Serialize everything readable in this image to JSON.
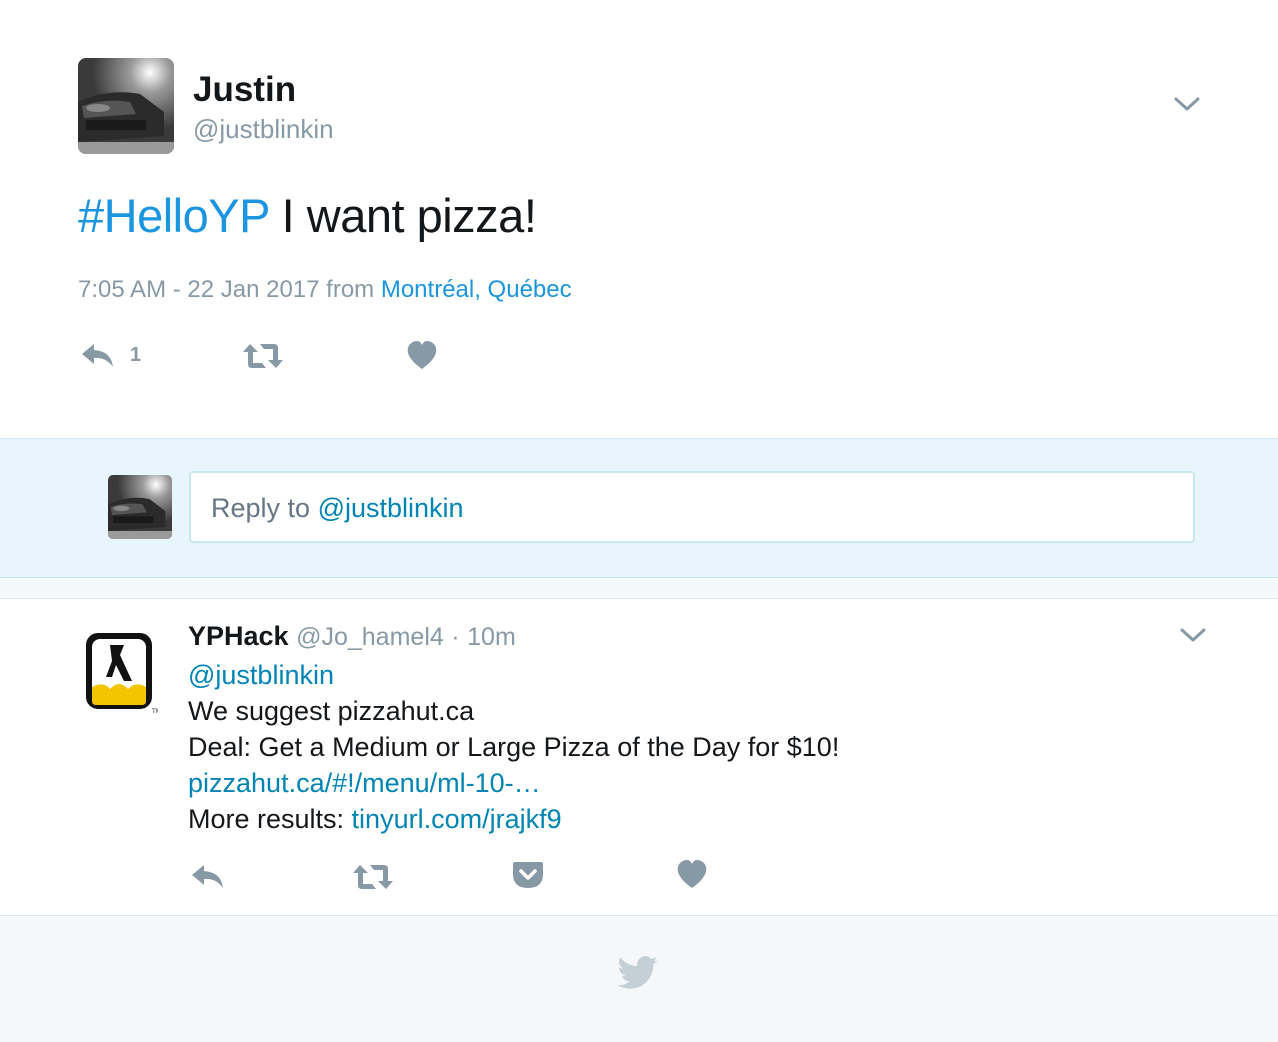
{
  "main_tweet": {
    "author_name": "Justin",
    "author_handle": "@justblinkin",
    "hashtag": "#HelloYP",
    "text": " I want pizza!",
    "timestamp": "7:05 AM - 22 Jan 2017 from ",
    "location": "Montréal, Québec",
    "reply_count": "1",
    "icons": [
      "reply-icon",
      "retweet-icon",
      "like-icon",
      "chevron-down-icon"
    ]
  },
  "reply_composer": {
    "placeholder_prefix": "Reply to ",
    "placeholder_mention": "@justblinkin"
  },
  "reply_tweet": {
    "author_name": "YPHack",
    "author_handle": "@Jo_hamel4",
    "separator": "·",
    "time": "10m",
    "lines": {
      "mention": "@justblinkin",
      "line1": "We suggest pizzahut.ca",
      "line2": "Deal: Get a Medium or Large Pizza of the Day for $10!",
      "link1": "pizzahut.ca/#!/menu/ml-10-…",
      "more_label": "More results: ",
      "link2": "tinyurl.com/jrajkf9"
    },
    "icons": [
      "reply-icon",
      "retweet-icon",
      "pocket-icon",
      "like-icon",
      "chevron-down-icon"
    ]
  },
  "footer": {
    "icon": "twitter-bird-icon"
  },
  "colors": {
    "link": "#1b95e0",
    "mention": "#0084b4",
    "muted": "#8899a6",
    "reply_bg": "#e8f5fd"
  }
}
